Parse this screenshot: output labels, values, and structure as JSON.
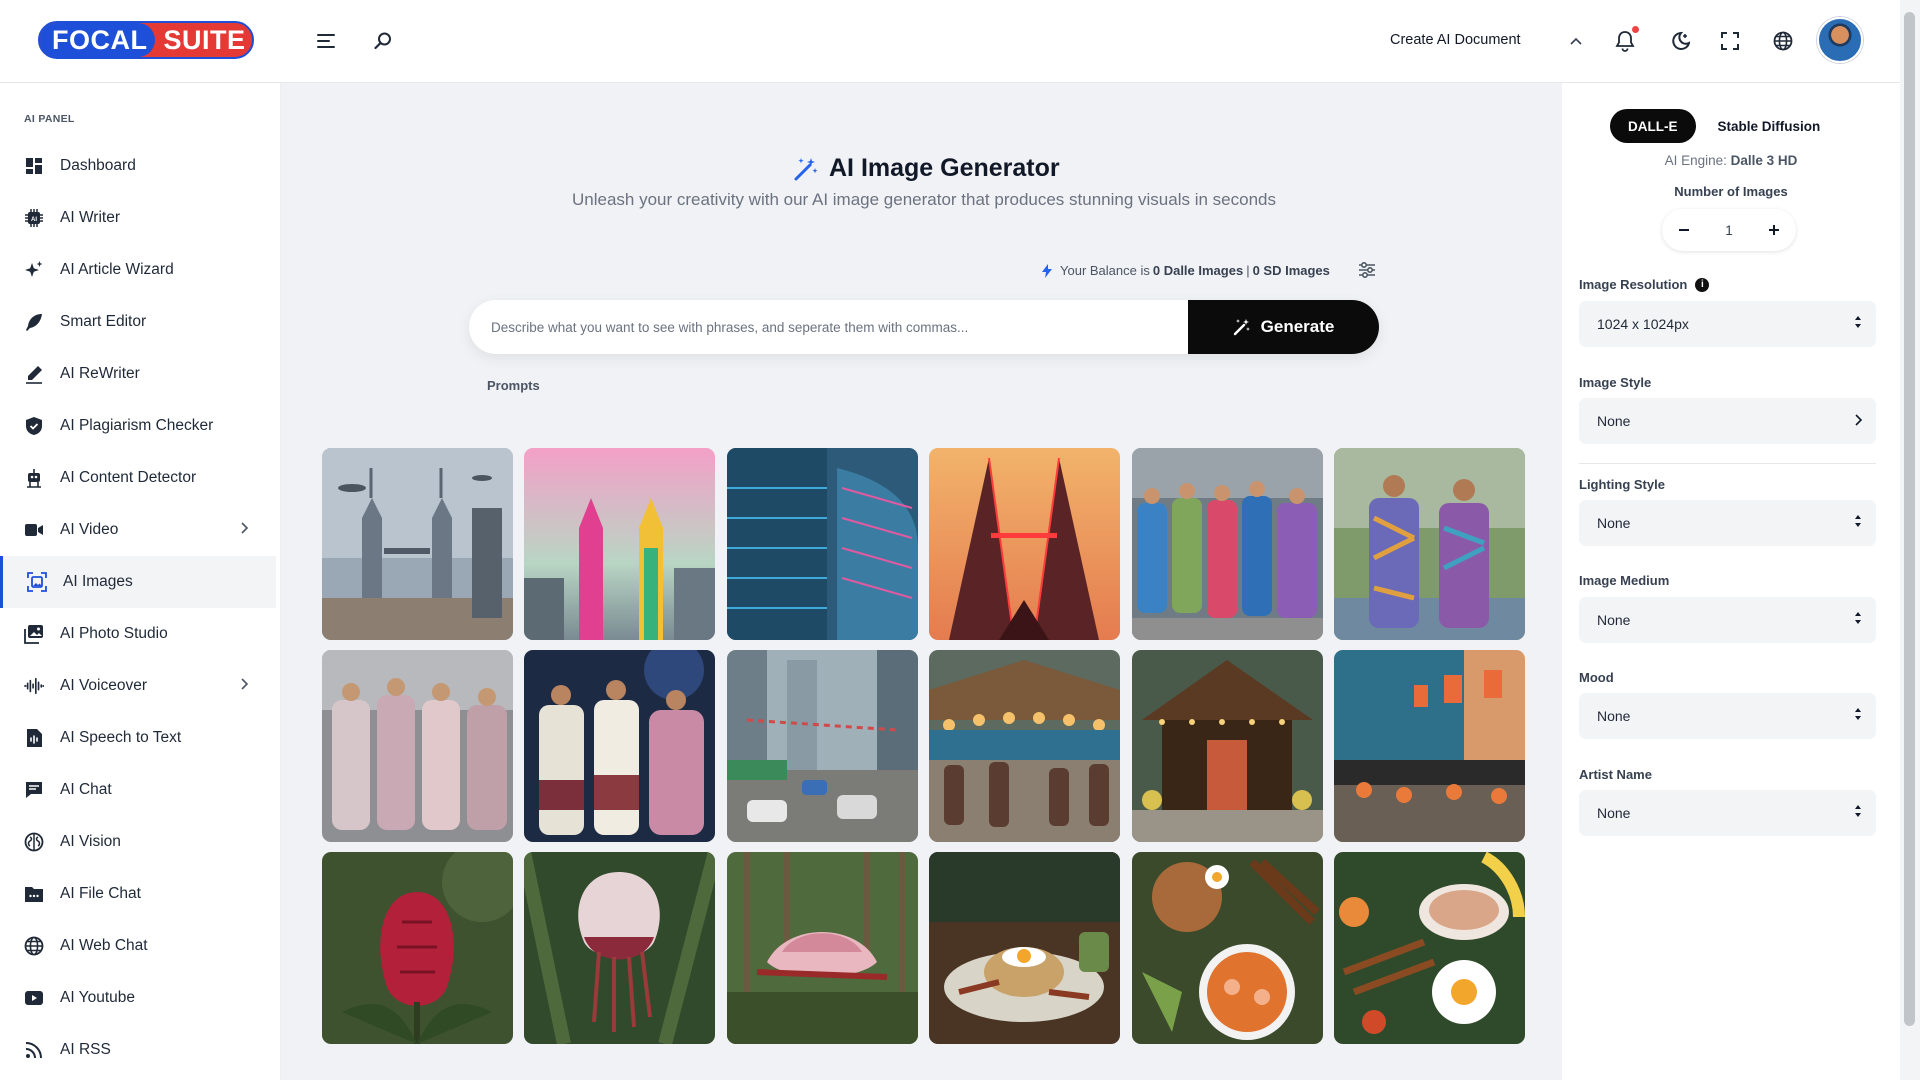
{
  "header": {
    "logo_left": "FOCAL",
    "logo_right": "SUITE",
    "create_doc_label": "Create AI Document"
  },
  "sidebar": {
    "panel_title": "AI PANEL",
    "items": [
      {
        "label": "Dashboard",
        "icon": "dashboard-icon"
      },
      {
        "label": "AI Writer",
        "icon": "chip-icon"
      },
      {
        "label": "AI Article Wizard",
        "icon": "sparkles-icon"
      },
      {
        "label": "Smart Editor",
        "icon": "feather-icon"
      },
      {
        "label": "AI ReWriter",
        "icon": "pen-icon"
      },
      {
        "label": "AI Plagiarism Checker",
        "icon": "shield-icon"
      },
      {
        "label": "AI Content Detector",
        "icon": "robot-icon"
      },
      {
        "label": "AI Video",
        "icon": "video-icon"
      },
      {
        "label": "AI Images",
        "icon": "image-scan-icon"
      },
      {
        "label": "AI Photo Studio",
        "icon": "photo-studio-icon"
      },
      {
        "label": "AI Voiceover",
        "icon": "waveform-icon"
      },
      {
        "label": "AI Speech to Text",
        "icon": "speech-file-icon"
      },
      {
        "label": "AI Chat",
        "icon": "chat-icon"
      },
      {
        "label": "AI Vision",
        "icon": "brain-icon"
      },
      {
        "label": "AI File Chat",
        "icon": "folder-chat-icon"
      },
      {
        "label": "AI Web Chat",
        "icon": "globe-icon"
      },
      {
        "label": "AI Youtube",
        "icon": "youtube-icon"
      },
      {
        "label": "AI RSS",
        "icon": "rss-icon"
      }
    ],
    "active_item": "AI Images"
  },
  "main": {
    "title": "AI Image Generator",
    "subtitle": "Unleash your creativity with our AI image generator that produces stunning visuals in seconds",
    "balance_prefix": "Your Balance is",
    "balance_dalle": "0 Dalle Images",
    "balance_sep": "|",
    "balance_sd": "0 SD Images",
    "prompt_placeholder": "Describe what you want to see with phrases, and seperate them with commas...",
    "generate_label": "Generate",
    "prompts_label": "Prompts"
  },
  "gallery": [
    "Twin towers under cloudy sky with floating ships",
    "Twin towers in pink and rainbow colors",
    "Blue glass skyscraper with neon stripes",
    "Twin towers at sunset with red neon outline",
    "Group in colorful traditional outfits",
    "Couple in patterned traditional outfits by lake",
    "Family in pastel traditional clothing",
    "Couple in traditional attire at gala",
    "Busy street with cars and bunting",
    "Festive market street with lanterns",
    "Traditional wooden pavilion with lights",
    "Street market with stalls at dusk",
    "Red tropical flower bud",
    "Pink flower bud among leaves",
    "Pink blooming flower in forest",
    "Rice plate with fried egg",
    "Noodles, prawn soup and satay",
    "Feast with fried egg and satay"
  ],
  "right_panel": {
    "tab_dalle": "DALL-E",
    "tab_sd": "Stable Diffusion",
    "engine_label": "AI Engine:",
    "engine_value": "Dalle 3 HD",
    "num_images_label": "Number of Images",
    "num_images_value": "1",
    "resolution_label": "Image Resolution",
    "resolution_value": "1024 x 1024px",
    "style_label": "Image Style",
    "style_value": "None",
    "lighting_label": "Lighting Style",
    "lighting_value": "None",
    "medium_label": "Image Medium",
    "medium_value": "None",
    "mood_label": "Mood",
    "mood_value": "None",
    "artist_label": "Artist Name",
    "artist_value": "None"
  },
  "colors": {
    "brand_blue": "#1e4fd8",
    "brand_red": "#e53935",
    "accent_black": "#0b0b0b",
    "notification_dot": "#ef4444"
  }
}
